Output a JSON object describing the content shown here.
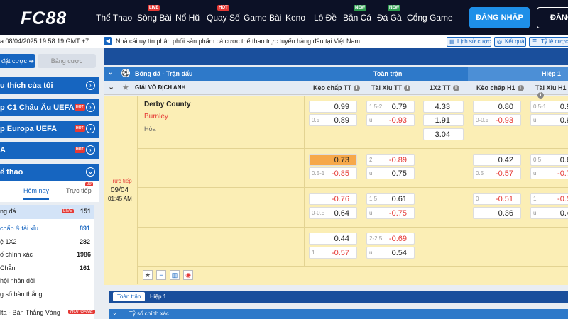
{
  "header": {
    "logo": "FC88",
    "nav": [
      {
        "label": "Thể Thao",
        "tag": ""
      },
      {
        "label": "Sòng Bài",
        "tag": "LIVE"
      },
      {
        "label": "Nổ Hũ",
        "tag": ""
      },
      {
        "label": "Quay Số",
        "tag": "HOT"
      },
      {
        "label": "Game Bài",
        "tag": ""
      },
      {
        "label": "Keno",
        "tag": ""
      },
      {
        "label": "Lô Đề",
        "tag": ""
      },
      {
        "label": "Bắn Cá",
        "tag": "NEW"
      },
      {
        "label": "Đá Gà",
        "tag": "NEW"
      },
      {
        "label": "Cổng Game",
        "tag": ""
      }
    ],
    "login": "ĐĂNG NHẬP",
    "register": "ĐĂNG"
  },
  "topbar": {
    "datetime": "a 08/04/2025 19:58:19 GMT +7",
    "notice": "Nhà cái uy tín phân phối sản phẩm cá cược thể thao trực tuyến hàng đầu tại Việt Nam.",
    "btn_history": "Lịch sử cược",
    "btn_results": "Kết quả",
    "btn_odds": "Tỷ lệ cược"
  },
  "sidebar": {
    "tab_placed": "đặt cược",
    "tab_table": "Bảng cược",
    "favorites": "u thích của tôi",
    "league1": "p C1 Châu Âu UEFA",
    "league2": "p Europa UEFA",
    "league3": "A",
    "hot": "HOT",
    "sports": "ể thao",
    "sub_today": "Hôm nay",
    "sub_live": "Trực tiếp",
    "live_badge": "29",
    "sport": {
      "label": "ng đá",
      "badge": "LIVE",
      "count": "151"
    },
    "markets": [
      {
        "label": "chấp & tài xỉu",
        "count": "891"
      },
      {
        "label": "ệ 1X2",
        "count": "282"
      },
      {
        "label": "ố chính xác",
        "count": "1986"
      },
      {
        "label": "Chẵn",
        "count": "161"
      },
      {
        "label": "hội nhân đôi",
        "count": ""
      },
      {
        "label": "g số bàn thắng",
        "count": ""
      }
    ],
    "bottom": "lta - Bàn Thắng Vàng",
    "bottom_tag": "HOT GAME"
  },
  "table": {
    "title": "Bóng đá - Trận đấu",
    "full": "Toàn trận",
    "half": "Hiệp 1",
    "league": "GIẢI VÔ ĐỊCH ANH",
    "cols": [
      "Kèo chấp TT",
      "Tài Xỉu TT",
      "1X2 TT",
      "Kèo chấp H1",
      "Tài Xỉu H1"
    ],
    "match": {
      "home": "Derby County",
      "away": "Burnley",
      "draw": "Hòa",
      "status": "Trực tiếp",
      "date": "09/04",
      "time": "01:45 AM"
    },
    "onex2": [
      "4.33",
      "1.91",
      "3.04"
    ],
    "bottom_tab1": "Toàn trận",
    "bottom_tab2": "Hiệp 1",
    "exact": "Tỷ số chính xác"
  },
  "rows": [
    {
      "ah": [
        [
          "",
          "0.99"
        ],
        [
          "0.5",
          "0.89"
        ]
      ],
      "ou": [
        [
          "1.5-2",
          "0.79"
        ],
        [
          "u",
          "-0.93"
        ]
      ],
      "ah1": [
        [
          "",
          "0.80"
        ],
        [
          "0-0.5",
          "-0.93"
        ]
      ],
      "ou1": [
        [
          "0.5-1",
          "0.9"
        ],
        [
          "u",
          "0.9"
        ]
      ]
    },
    {
      "ah": [
        [
          "",
          "0.73"
        ],
        [
          "0.5-1",
          "-0.85"
        ]
      ],
      "ou": [
        [
          "2",
          "-0.89"
        ],
        [
          "u",
          "0.75"
        ]
      ],
      "ah1": [
        [
          "",
          "0.42"
        ],
        [
          "0.5",
          "-0.57"
        ]
      ],
      "ou1": [
        [
          "0.5",
          "0.6"
        ],
        [
          "u",
          "-0.7"
        ]
      ]
    },
    {
      "ah": [
        [
          "",
          "-0.76"
        ],
        [
          "0-0.5",
          "0.64"
        ]
      ],
      "ou": [
        [
          "1.5",
          "0.61"
        ],
        [
          "u",
          "-0.75"
        ]
      ],
      "ah1": [
        [
          "0",
          "-0.51"
        ],
        [
          "",
          "0.36"
        ]
      ],
      "ou1": [
        [
          "1",
          "-0.5"
        ],
        [
          "u",
          "0.4"
        ]
      ]
    },
    {
      "ah": [
        [
          "",
          "0.44"
        ],
        [
          "1",
          "-0.57"
        ]
      ],
      "ou": [
        [
          "2-2.5",
          "-0.69"
        ],
        [
          "u",
          "0.54"
        ]
      ],
      "ah1": [],
      "ou1": []
    }
  ],
  "colors": {
    "header_bg": "#0c1126",
    "primary": "#1665c0",
    "row_bg": "#fbeeb5",
    "neg": "#e53935",
    "hl": "#f6a84a"
  }
}
